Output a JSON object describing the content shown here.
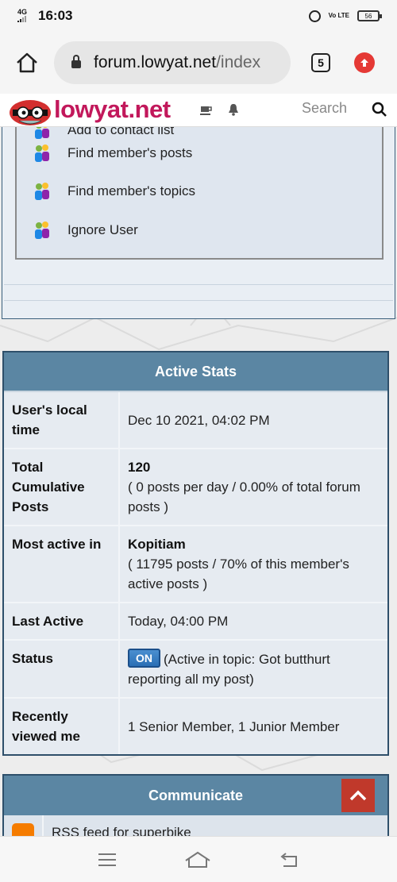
{
  "status_bar": {
    "network": "4G",
    "time": "16:03",
    "volte": "Vo LTE",
    "battery": "56"
  },
  "browser": {
    "url_host": "forum.lowyat.net",
    "url_path": "/index",
    "tab_count": "5"
  },
  "site_header": {
    "logo_text": "lowyat.net",
    "search_placeholder": "Search"
  },
  "options": {
    "items": [
      {
        "label": "Add to contact list"
      },
      {
        "label": "Find member's posts"
      },
      {
        "label": "Find member's topics"
      },
      {
        "label": "Ignore User"
      }
    ]
  },
  "active_stats": {
    "title": "Active Stats",
    "rows": [
      {
        "label": "User's local time",
        "value": "Dec 10 2021, 04:02 PM"
      },
      {
        "label": "Total Cumulative Posts",
        "value_bold": "120",
        "value": "( 0 posts per day / 0.00% of total forum posts )"
      },
      {
        "label": "Most active in",
        "value_bold": "Kopitiam",
        "value": "( 11795 posts / 70% of this member's active posts )"
      },
      {
        "label": "Last Active",
        "value": "Today, 04:00 PM"
      },
      {
        "label": "Status",
        "badge": "ON",
        "value": "(Active in topic: Got butthurt reporting all my post)"
      },
      {
        "label": "Recently viewed me",
        "value": "1 Senior Member, 1 Junior Member"
      }
    ]
  },
  "communicate": {
    "title": "Communicate",
    "rss_label": "RSS feed for superbike"
  },
  "colors": {
    "header_blue": "#5b86a3",
    "logo_pink": "#c2185b",
    "scroll_top_red": "#c0392b",
    "on_badge_blue": "#2a6fb5"
  }
}
